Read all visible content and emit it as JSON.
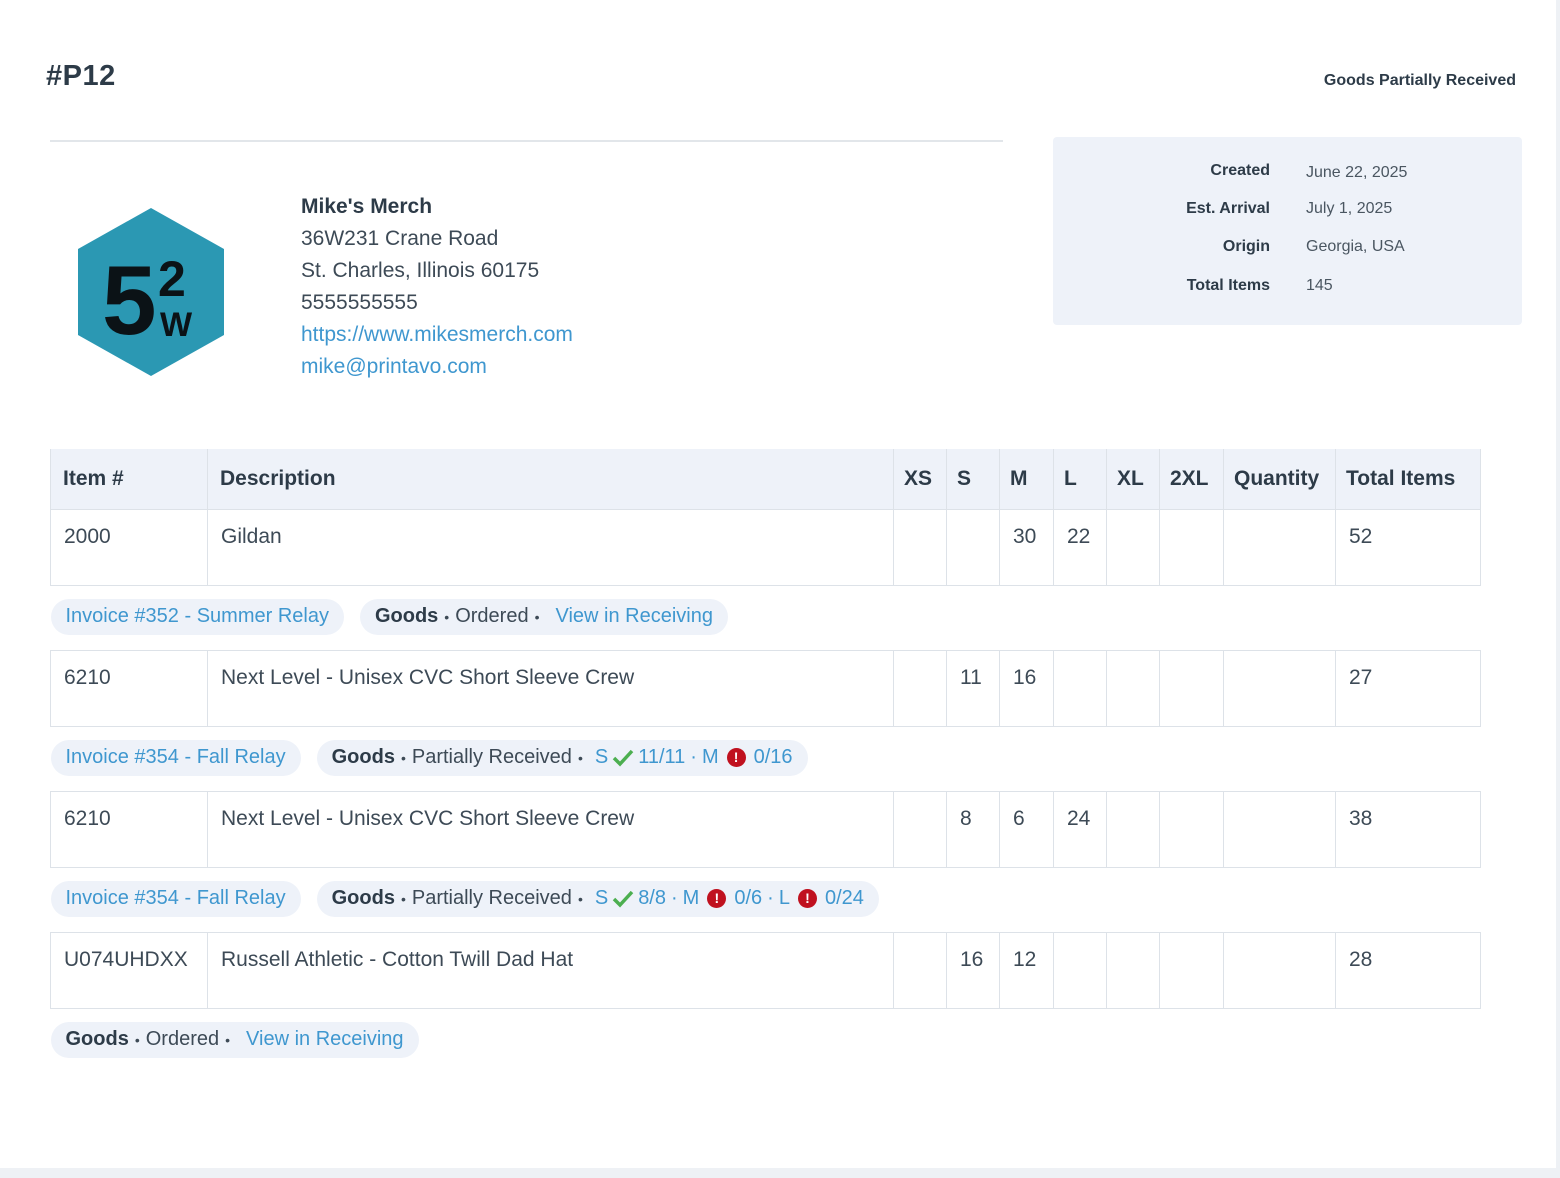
{
  "header": {
    "po_number": "#P12",
    "status": "Goods Partially Received"
  },
  "vendor": {
    "name": "Mike's Merch",
    "address1": "36W231 Crane Road",
    "address2": "St. Charles, Illinois 60175",
    "phone": "5555555555",
    "website": "https://www.mikesmerch.com",
    "email": "mike@printavo.com",
    "logo_text": "52W",
    "logo_color": "#2b98b3"
  },
  "details": {
    "created_label": "Created",
    "created_value": "June 22, 2025",
    "arrival_label": "Est. Arrival",
    "arrival_value": "July 1, 2025",
    "origin_label": "Origin",
    "origin_value": "Georgia, USA",
    "total_label": "Total Items",
    "total_value": "145"
  },
  "table": {
    "columns": [
      "Item #",
      "Description",
      "XS",
      "S",
      "M",
      "L",
      "XL",
      "2XL",
      "Quantity",
      "Total Items"
    ],
    "rows": [
      {
        "cells": [
          "2000",
          "Gildan",
          "",
          "",
          "30",
          "22",
          "",
          "",
          "",
          "52"
        ],
        "invoice": "Invoice #352 - Summer Relay",
        "goods": "Goods",
        "state": "Ordered",
        "action": "View in Receiving"
      },
      {
        "cells": [
          "6210",
          "Next Level - Unisex CVC Short Sleeve Crew",
          "",
          "11",
          "16",
          "",
          "",
          "",
          "",
          "27"
        ],
        "invoice": "Invoice #354 - Fall Relay",
        "goods": "Goods",
        "state": "Partially Received",
        "sizes": [
          {
            "size": "S",
            "status": "ok",
            "count": "11/11"
          },
          {
            "size": "M",
            "status": "warn",
            "count": "0/16"
          }
        ]
      },
      {
        "cells": [
          "6210",
          "Next Level - Unisex CVC Short Sleeve Crew",
          "",
          "8",
          "6",
          "24",
          "",
          "",
          "",
          "38"
        ],
        "invoice": "Invoice #354 - Fall Relay",
        "goods": "Goods",
        "state": "Partially Received",
        "sizes": [
          {
            "size": "S",
            "status": "ok",
            "count": "8/8"
          },
          {
            "size": "M",
            "status": "warn",
            "count": "0/6"
          },
          {
            "size": "L",
            "status": "warn",
            "count": "0/24"
          }
        ]
      },
      {
        "cells": [
          "U074UHDXX",
          "Russell Athletic - Cotton Twill Dad Hat",
          "",
          "16",
          "12",
          "",
          "",
          "",
          "",
          "28"
        ],
        "goods": "Goods",
        "state": "Ordered",
        "action": "View in Receiving"
      }
    ]
  },
  "colors": {
    "accent": "#3f97cf",
    "ok": "#4caf50",
    "warn": "#c0111f",
    "panel": "#eef2f9"
  },
  "icons": {
    "ok": "check-icon",
    "warn": "exclamation-circle-icon",
    "bullet": "•"
  }
}
